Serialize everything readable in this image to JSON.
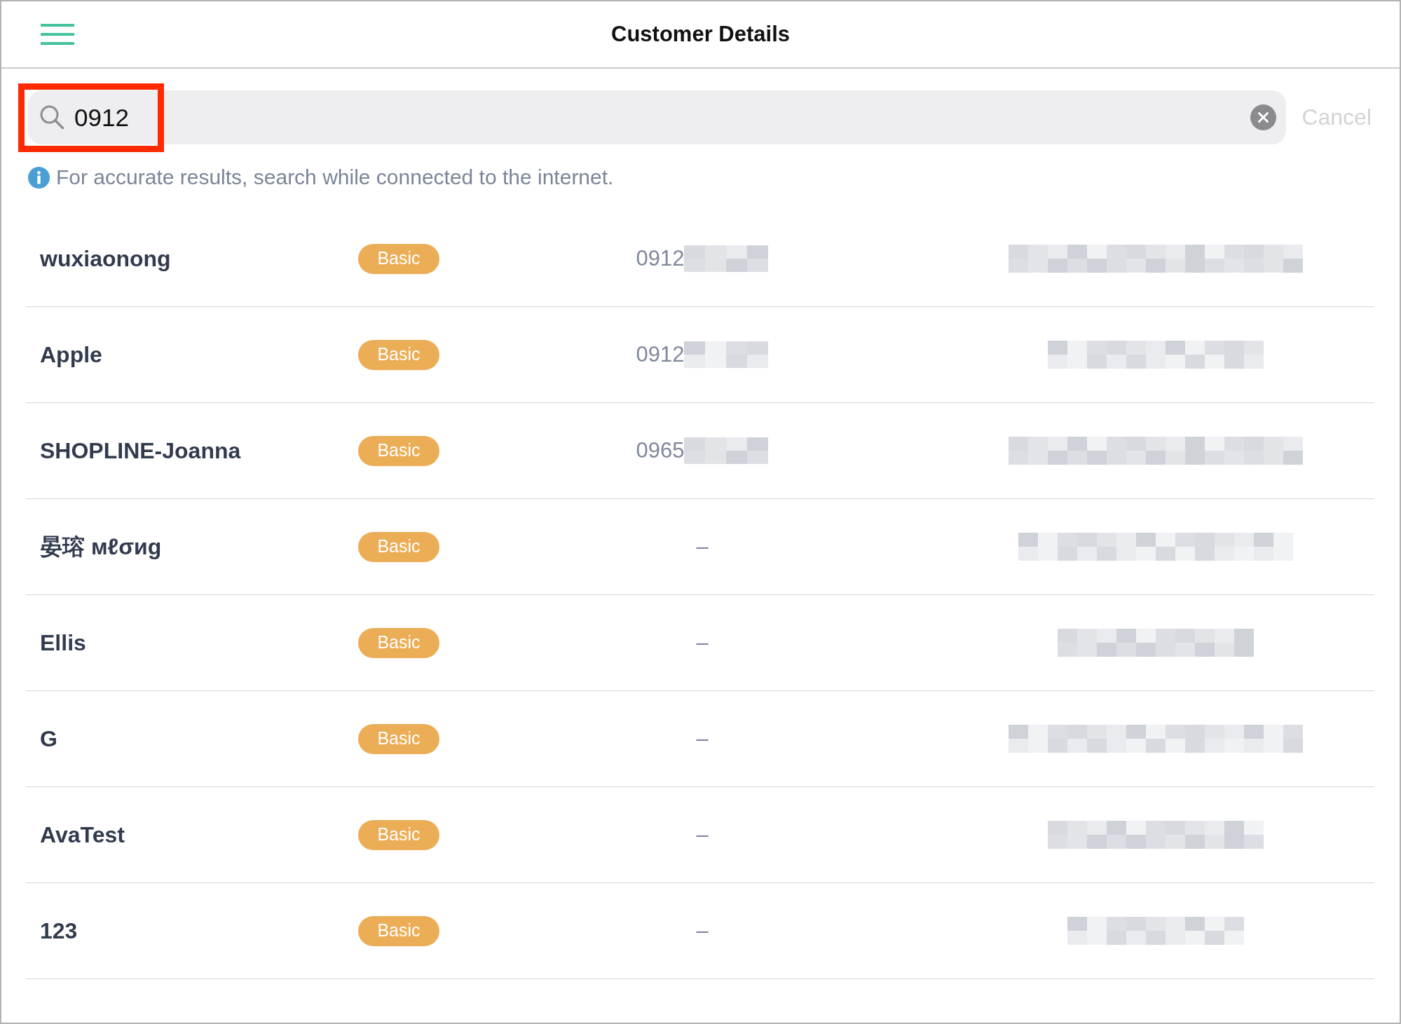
{
  "header": {
    "title": "Customer Details"
  },
  "search": {
    "value": "0912",
    "highlighted": true,
    "cancel_label": "Cancel"
  },
  "notice": {
    "text": "For accurate results, search while connected to the internet."
  },
  "customers": [
    {
      "name": "wuxiaonong",
      "tier": "Basic",
      "phone": "0912",
      "phone_masked": true,
      "email_masked": true
    },
    {
      "name": "Apple",
      "tier": "Basic",
      "phone": "0912",
      "phone_masked": true,
      "email_masked": true
    },
    {
      "name": "SHOPLINE-Joanna",
      "tier": "Basic",
      "phone": "0965",
      "phone_masked": true,
      "email_masked": true
    },
    {
      "name": "晏瑢 мℓσиg",
      "tier": "Basic",
      "phone": "–",
      "phone_masked": false,
      "email_masked": true
    },
    {
      "name": "Ellis",
      "tier": "Basic",
      "phone": "–",
      "phone_masked": false,
      "email_masked": true
    },
    {
      "name": "G",
      "tier": "Basic",
      "phone": "–",
      "phone_masked": false,
      "email_masked": true
    },
    {
      "name": "AvaTest",
      "tier": "Basic",
      "phone": "–",
      "phone_masked": false,
      "email_masked": true
    },
    {
      "name": "123",
      "tier": "Basic",
      "phone": "–",
      "phone_masked": false,
      "email_masked": true
    }
  ]
}
